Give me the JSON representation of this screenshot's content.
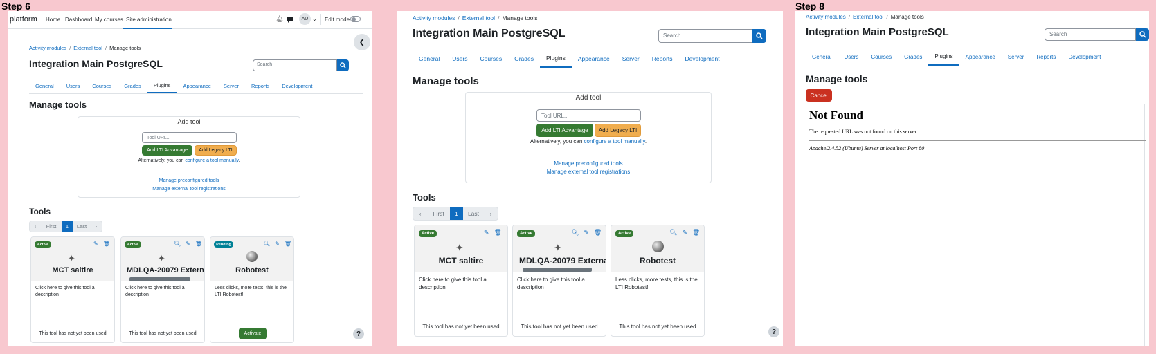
{
  "steps": [
    {
      "label": "Step 6"
    },
    {
      "label": ""
    },
    {
      "label": "Step 8"
    }
  ],
  "navbar": {
    "brand": "platform",
    "items": [
      "Home",
      "Dashboard",
      "My courses",
      "Site administration"
    ],
    "avatar": "AU",
    "edit_mode": "Edit mode"
  },
  "breadcrumb": [
    "Activity modules",
    "External tool",
    "Manage tools"
  ],
  "page_title": "Integration Main PostgreSQL",
  "search_placeholder": "Search",
  "tabs": [
    "General",
    "Users",
    "Courses",
    "Grades",
    "Plugins",
    "Appearance",
    "Server",
    "Reports",
    "Development"
  ],
  "active_tab": "Plugins",
  "manage_title": "Manage tools",
  "add_tool": {
    "title": "Add tool",
    "url_placeholder": "Tool URL...",
    "advantage_btn": "Add LTI Advantage",
    "legacy_btn": "Add Legacy LTI",
    "alt_prefix": "Alternatively, you can ",
    "alt_link": "configure a tool manually",
    "alt_suffix": ".",
    "link_preconfigured": "Manage preconfigured tools",
    "link_registrations": "Manage external tool registrations"
  },
  "tools_title": "Tools",
  "pager": {
    "first": "First",
    "current": "1",
    "last": "Last"
  },
  "cards": [
    {
      "status": "Active",
      "name": "MCT saltire",
      "desc": "Click here to give this tool a description",
      "footer": "This tool has not yet been used"
    },
    {
      "status": "Active",
      "name": "MDLQA-20079 External",
      "desc": "Click here to give this tool a description",
      "footer": "This tool has not yet been used"
    },
    {
      "status": "Pending",
      "name": "Robotest",
      "desc": "Less clicks, more tests, this is the LTI Robotest!",
      "footer": "",
      "action": "Activate"
    }
  ],
  "cards_step7": [
    {
      "status": "Active",
      "name": "MCT saltire",
      "desc": "Click here to give this tool a description",
      "footer": "This tool has not yet been used"
    },
    {
      "status": "Active",
      "name": "MDLQA-20079 External",
      "desc": "Click here to give this tool a description",
      "footer": "This tool has not yet been used"
    },
    {
      "status": "Active",
      "name": "Robotest",
      "desc": "Less clicks, more tests, this is the LTI Robotest!",
      "footer": "This tool has not yet been used"
    }
  ],
  "step8": {
    "cancel": "Cancel",
    "nf_title": "Not Found",
    "nf_text": "The requested URL was not found on this server.",
    "nf_server": "Apache/2.4.52 (Ubuntu) Server at localhost Port 80"
  },
  "help": "?",
  "colors": {
    "primary": "#0f6cbf",
    "success": "#357a32",
    "warning": "#f0ad4e",
    "danger": "#ca3120",
    "info": "#008196",
    "background": "#f8c8cf"
  }
}
